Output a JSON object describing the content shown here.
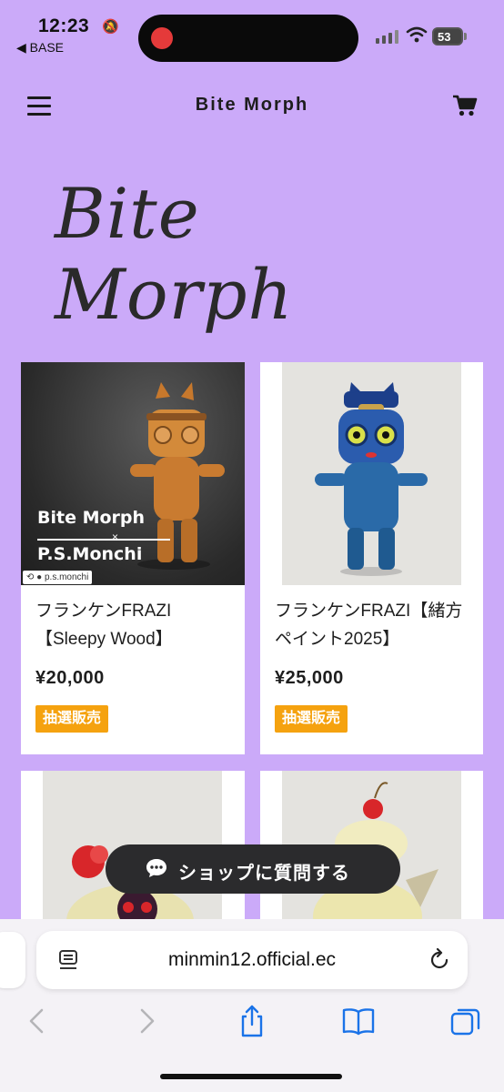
{
  "status_bar": {
    "time": "12:23",
    "back_app": "◀ BASE",
    "battery": "53"
  },
  "header": {
    "title": "Bite Morph",
    "menu_icon": "hamburger-menu-icon",
    "cart_icon": "cart-icon"
  },
  "logo": {
    "text": "Bite Morph"
  },
  "products": [
    {
      "name": "フランケンFRAZI【Sleepy Wood】",
      "price": "¥20,000",
      "badge": "抽選販売",
      "overlay_brand": "Bite Morph",
      "overlay_x": "×",
      "overlay_collab": "P.S.Monchi",
      "repost_tag": "p.s.monchi"
    },
    {
      "name": "フランケンFRAZI【緒方ペイント2025】",
      "price": "¥25,000",
      "badge": "抽選販売"
    },
    {},
    {}
  ],
  "ask_button": {
    "label": "ショップに質問する",
    "icon": "chat-bubble-icon"
  },
  "browser": {
    "url": "minmin12.official.ec",
    "reader_icon": "reader-mode-icon",
    "reload_icon": "reload-icon",
    "nav": [
      "back-arrow-icon",
      "forward-arrow-icon",
      "share-icon",
      "bookmarks-icon",
      "tabs-icon"
    ]
  },
  "colors": {
    "background": "#cbaaf9",
    "badge": "#f5a20f",
    "ask_button": "#2b2b2d",
    "ios_blue": "#1a73e8"
  }
}
